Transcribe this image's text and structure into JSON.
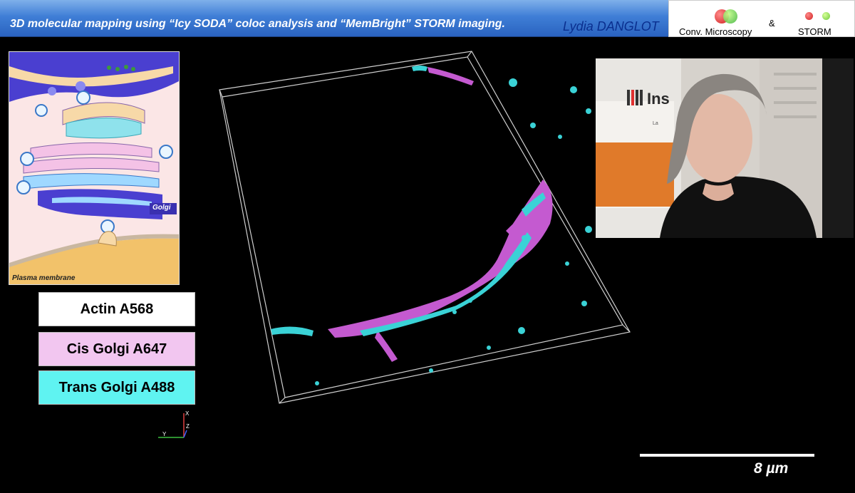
{
  "header": {
    "title": "3D molecular mapping using “Icy SODA” coloc analysis and “MemBright” STORM imaging.",
    "author": "Lydia DANGLOT",
    "legend": {
      "conv_label": "Conv. Microscopy",
      "ampersand": "&",
      "storm_label": "STORM"
    }
  },
  "schema": {
    "golgi_label": "Golgi",
    "membrane_label": "Plasma membrane"
  },
  "channels": [
    {
      "label": "Actin A568",
      "color": "#ffffff"
    },
    {
      "label": "Cis Golgi A647",
      "color": "#f2c6f0"
    },
    {
      "label": "Trans Golgi A488",
      "color": "#5ff3f1"
    }
  ],
  "axes": {
    "x": "X",
    "y": "Y",
    "z": "Z"
  },
  "webcam": {
    "logo_text": "Ins",
    "sub_text": "La"
  },
  "scale": {
    "label": "8 µm"
  },
  "colors": {
    "cis_golgi": "#c45ad0",
    "trans_golgi": "#3ad2d6",
    "title_text": "#ffffff",
    "author_text": "#0a2f8f"
  }
}
